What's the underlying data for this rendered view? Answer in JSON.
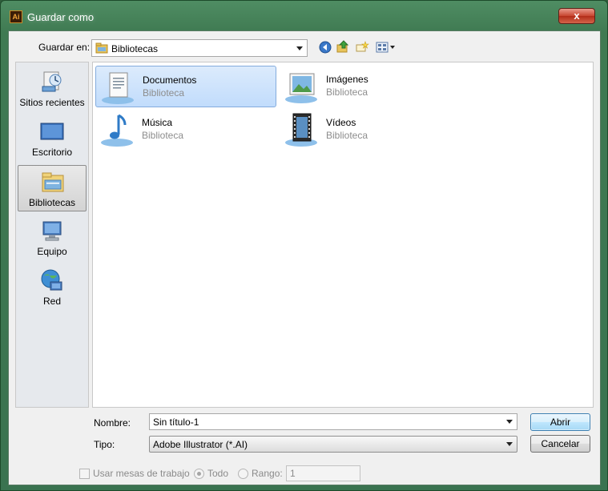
{
  "window": {
    "title": "Guardar como",
    "app_icon_text": "Ai",
    "close_label": "x"
  },
  "toolbar": {
    "save_in_label": "Guardar en:",
    "location": "Bibliotecas",
    "buttons": [
      "back-icon",
      "up-folder-icon",
      "new-folder-icon",
      "view-menu-icon"
    ]
  },
  "places": {
    "items": [
      {
        "label": "Sitios recientes",
        "icon": "recent-places-icon"
      },
      {
        "label": "Escritorio",
        "icon": "desktop-icon"
      },
      {
        "label": "Bibliotecas",
        "icon": "libraries-icon",
        "selected": true
      },
      {
        "label": "Equipo",
        "icon": "computer-icon"
      },
      {
        "label": "Red",
        "icon": "network-icon"
      }
    ]
  },
  "files": {
    "items": [
      {
        "name": "Documentos",
        "type": "Biblioteca",
        "icon": "documents-library-icon",
        "selected": true
      },
      {
        "name": "Imágenes",
        "type": "Biblioteca",
        "icon": "pictures-library-icon"
      },
      {
        "name": "Música",
        "type": "Biblioteca",
        "icon": "music-library-icon"
      },
      {
        "name": "Vídeos",
        "type": "Biblioteca",
        "icon": "videos-library-icon"
      }
    ]
  },
  "form": {
    "name_label": "Nombre:",
    "name_value": "Sin título-1",
    "type_label": "Tipo:",
    "type_value": "Adobe Illustrator (*.AI)",
    "open_button": "Abrir",
    "cancel_button": "Cancelar"
  },
  "options": {
    "artboards_label": "Usar mesas de trabajo",
    "all_label": "Todo",
    "range_label": "Rango:",
    "range_value": "1"
  }
}
